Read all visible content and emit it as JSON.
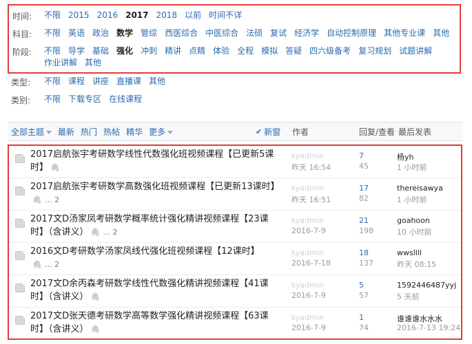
{
  "filters": {
    "time": {
      "label": "时间:",
      "options": [
        "不限",
        "2015",
        "2016",
        "2017",
        "2018",
        "以前",
        "时间不详"
      ],
      "active": "2017"
    },
    "subject": {
      "label": "科目:",
      "options": [
        "不限",
        "英语",
        "政治",
        "数学",
        "管综",
        "西医综合",
        "中医综合",
        "法硕",
        "复试",
        "经济学",
        "自动控制原理",
        "其他专业课",
        "其他"
      ],
      "active": "数学"
    },
    "stage": {
      "label": "阶段:",
      "options": [
        "不限",
        "导学",
        "基础",
        "强化",
        "冲刺",
        "精讲",
        "点睛",
        "体验",
        "全程",
        "模拟",
        "答疑",
        "四六级备考",
        "复习规划",
        "试题讲解",
        "作业讲解",
        "其他"
      ],
      "active": "强化"
    },
    "type": {
      "label": "类型:",
      "options": [
        "不限",
        "课程",
        "讲座",
        "直播课",
        "其他"
      ]
    },
    "category": {
      "label": "类别:",
      "options": [
        "不限",
        "下载专区",
        "在线课程"
      ]
    }
  },
  "toolbar": {
    "all_topics": "全部主题",
    "links": [
      "最新",
      "热门",
      "热帖",
      "精华"
    ],
    "more": "更多",
    "new_window": "新窗",
    "col_author": "作者",
    "col_replies": "回复/查看",
    "col_last": "最后发表"
  },
  "threads": [
    {
      "title": "2017启航张宇考研数学线性代数强化班视频课程【已更新5课时】",
      "attachment": true,
      "pages": "",
      "author": "kyadmin",
      "date": "昨天 16:54",
      "replies": "7",
      "views": "45",
      "last_user": "杨yh",
      "last_time": "1 小时前"
    },
    {
      "title": "2017启航张宇考研数学高数强化班视频课程【已更新13课时】",
      "attachment": true,
      "pages": "... 2",
      "author": "kyadmin",
      "date": "昨天 16:51",
      "replies": "17",
      "views": "82",
      "last_user": "thereisawya",
      "last_time": "1 小时前"
    },
    {
      "title": "2017文D汤家凤考研数学概率统计强化精讲视频课程【23课时】（含讲义）",
      "attachment": true,
      "pages": "... 2",
      "author": "kyadmin",
      "date": "2016-7-9",
      "replies": "21",
      "views": "198",
      "last_user": "goahoon",
      "last_time": "10 小时前"
    },
    {
      "title": "2016文D考研数学汤家凤线代强化班视频课程【12课时】",
      "attachment": true,
      "pages": "... 2",
      "author": "kyadmin",
      "date": "2016-7-18",
      "replies": "18",
      "views": "137",
      "last_user": "wwsllll",
      "last_time": "昨天 08:15"
    },
    {
      "title": "2017文D余丙森考研数学线性代数强化精讲视频课程【41课时】（含讲义）",
      "attachment": true,
      "pages": "",
      "author": "kyadmin",
      "date": "2016-7-9",
      "replies": "5",
      "views": "57",
      "last_user": "1592446487yyj",
      "last_time": "5 天前"
    },
    {
      "title": "2017文D张天德考研数学高等数学强化精讲视频课程【63课时】（含讲义）",
      "attachment": true,
      "pages": "",
      "author": "kyadmin",
      "date": "2016-7-9",
      "replies": "1",
      "views": "74",
      "last_user": "谁谁谁水水水",
      "last_time": "2016-7-13 19:24"
    }
  ]
}
